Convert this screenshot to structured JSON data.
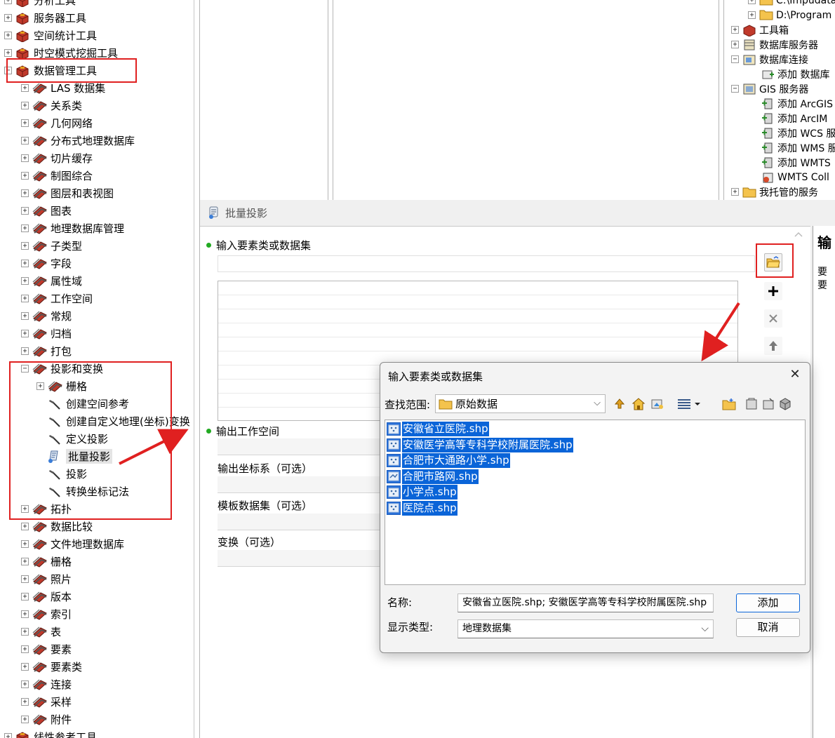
{
  "toolbox": {
    "items": [
      {
        "label": "分析工具",
        "level": 0,
        "expander": "+",
        "icon": "red-toolbox-icon"
      },
      {
        "label": "服务器工具",
        "level": 0,
        "expander": "+",
        "icon": "red-toolbox-icon"
      },
      {
        "label": "空间统计工具",
        "level": 0,
        "expander": "+",
        "icon": "red-toolbox-icon"
      },
      {
        "label": "时空模式挖掘工具",
        "level": 0,
        "expander": "+",
        "icon": "red-toolbox-icon"
      },
      {
        "label": "数据管理工具",
        "level": 0,
        "expander": "-",
        "icon": "red-toolbox-icon"
      },
      {
        "label": "LAS 数据集",
        "level": 1,
        "expander": "+",
        "icon": "toolset-icon"
      },
      {
        "label": "关系类",
        "level": 1,
        "expander": "+",
        "icon": "toolset-icon"
      },
      {
        "label": "几何网络",
        "level": 1,
        "expander": "+",
        "icon": "toolset-icon"
      },
      {
        "label": "分布式地理数据库",
        "level": 1,
        "expander": "+",
        "icon": "toolset-icon"
      },
      {
        "label": "切片缓存",
        "level": 1,
        "expander": "+",
        "icon": "toolset-icon"
      },
      {
        "label": "制图综合",
        "level": 1,
        "expander": "+",
        "icon": "toolset-icon"
      },
      {
        "label": "图层和表视图",
        "level": 1,
        "expander": "+",
        "icon": "toolset-icon"
      },
      {
        "label": "图表",
        "level": 1,
        "expander": "+",
        "icon": "toolset-icon"
      },
      {
        "label": "地理数据库管理",
        "level": 1,
        "expander": "+",
        "icon": "toolset-icon"
      },
      {
        "label": "子类型",
        "level": 1,
        "expander": "+",
        "icon": "toolset-icon"
      },
      {
        "label": "字段",
        "level": 1,
        "expander": "+",
        "icon": "toolset-icon"
      },
      {
        "label": "属性域",
        "level": 1,
        "expander": "+",
        "icon": "toolset-icon"
      },
      {
        "label": "工作空间",
        "level": 1,
        "expander": "+",
        "icon": "toolset-icon"
      },
      {
        "label": "常规",
        "level": 1,
        "expander": "+",
        "icon": "toolset-icon"
      },
      {
        "label": "归档",
        "level": 1,
        "expander": "+",
        "icon": "toolset-icon"
      },
      {
        "label": "打包",
        "level": 1,
        "expander": "+",
        "icon": "toolset-icon"
      },
      {
        "label": "投影和变换",
        "level": 1,
        "expander": "-",
        "icon": "toolset-icon"
      },
      {
        "label": "栅格",
        "level": 2,
        "expander": "+",
        "icon": "toolset-icon"
      },
      {
        "label": "创建空间参考",
        "level": 2,
        "expander": "",
        "icon": "hammer-icon"
      },
      {
        "label": "创建自定义地理(坐标)变换",
        "level": 2,
        "expander": "",
        "icon": "hammer-icon"
      },
      {
        "label": "定义投影",
        "level": 2,
        "expander": "",
        "icon": "hammer-icon"
      },
      {
        "label": "批量投影",
        "level": 2,
        "expander": "",
        "icon": "script-icon"
      },
      {
        "label": "投影",
        "level": 2,
        "expander": "",
        "icon": "hammer-icon"
      },
      {
        "label": "转换坐标记法",
        "level": 2,
        "expander": "",
        "icon": "hammer-icon"
      },
      {
        "label": "拓扑",
        "level": 1,
        "expander": "+",
        "icon": "toolset-icon"
      },
      {
        "label": "数据比较",
        "level": 1,
        "expander": "+",
        "icon": "toolset-icon"
      },
      {
        "label": "文件地理数据库",
        "level": 1,
        "expander": "+",
        "icon": "toolset-icon"
      },
      {
        "label": "栅格",
        "level": 1,
        "expander": "+",
        "icon": "toolset-icon"
      },
      {
        "label": "照片",
        "level": 1,
        "expander": "+",
        "icon": "toolset-icon"
      },
      {
        "label": "版本",
        "level": 1,
        "expander": "+",
        "icon": "toolset-icon"
      },
      {
        "label": "索引",
        "level": 1,
        "expander": "+",
        "icon": "toolset-icon"
      },
      {
        "label": "表",
        "level": 1,
        "expander": "+",
        "icon": "toolset-icon"
      },
      {
        "label": "要素",
        "level": 1,
        "expander": "+",
        "icon": "toolset-icon"
      },
      {
        "label": "要素类",
        "level": 1,
        "expander": "+",
        "icon": "toolset-icon"
      },
      {
        "label": "连接",
        "level": 1,
        "expander": "+",
        "icon": "toolset-icon"
      },
      {
        "label": "采样",
        "level": 1,
        "expander": "+",
        "icon": "toolset-icon"
      },
      {
        "label": "附件",
        "level": 1,
        "expander": "+",
        "icon": "toolset-icon"
      },
      {
        "label": "线性参考工具",
        "level": 0,
        "expander": "+",
        "icon": "red-toolbox-icon"
      }
    ]
  },
  "catalog": {
    "items": [
      {
        "label": "C:\\Impudata",
        "level": 1,
        "expander": "+",
        "icon": "folder-icon"
      },
      {
        "label": "D:\\Program",
        "level": 1,
        "expander": "+",
        "icon": "folder-icon"
      },
      {
        "label": "工具箱",
        "level": 0,
        "expander": "+",
        "icon": "toolbox-icon"
      },
      {
        "label": "数据库服务器",
        "level": 0,
        "expander": "+",
        "icon": "database-server-icon"
      },
      {
        "label": "数据库连接",
        "level": 0,
        "expander": "-",
        "icon": "database-connection-icon"
      },
      {
        "label": "添加 数据库",
        "level": 1,
        "expander": "",
        "icon": "add-connection-icon"
      },
      {
        "label": "GIS 服务器",
        "level": 0,
        "expander": "-",
        "icon": "gis-server-icon"
      },
      {
        "label": "添加 ArcGIS",
        "level": 1,
        "expander": "",
        "icon": "add-server-icon"
      },
      {
        "label": "添加 ArcIM",
        "level": 1,
        "expander": "",
        "icon": "add-server-icon"
      },
      {
        "label": "添加 WCS 服",
        "level": 1,
        "expander": "",
        "icon": "add-server-icon"
      },
      {
        "label": "添加 WMS 服",
        "level": 1,
        "expander": "",
        "icon": "add-server-icon"
      },
      {
        "label": "添加 WMTS",
        "level": 1,
        "expander": "",
        "icon": "add-server-icon"
      },
      {
        "label": "WMTS Coll",
        "level": 1,
        "expander": "",
        "icon": "wmts-icon"
      },
      {
        "label": "我托管的服务",
        "level": 0,
        "expander": "+",
        "icon": "hosted-services-icon"
      }
    ]
  },
  "tool": {
    "title": "批量投影",
    "input_label": "输入要素类或数据集",
    "output_workspace_label": "输出工作空间",
    "output_cs_label": "输出坐标系（可选）",
    "template_label": "模板数据集（可选）",
    "transform_label": "变换（可选）",
    "help_title_partial": "输",
    "help_text_line1": "要",
    "help_text_line2": "要"
  },
  "dialog": {
    "title": "输入要素类或数据集",
    "close_glyph": "✕",
    "look_in_label": "查找范围:",
    "look_in_value": "原始数据",
    "files": [
      {
        "name": "安徽省立医院.shp",
        "icon": "point-feature-icon"
      },
      {
        "name": "安徽医学高等专科学校附属医院.shp",
        "icon": "point-feature-icon"
      },
      {
        "name": "合肥市大通路小学.shp",
        "icon": "point-feature-icon"
      },
      {
        "name": "合肥市路网.shp",
        "icon": "line-feature-icon"
      },
      {
        "name": "小学点.shp",
        "icon": "point-feature-icon"
      },
      {
        "name": "医院点.shp",
        "icon": "point-feature-icon"
      }
    ],
    "name_label": "名称:",
    "name_value": "安徽省立医院.shp; 安徽医学高等专科学校附属医院.shp",
    "type_label": "显示类型:",
    "type_value": "地理数据集",
    "add_button": "添加",
    "cancel_button": "取消"
  },
  "colors": {
    "annotation_red": "#e02020",
    "selection_blue": "#0a64d8",
    "required_dot_green": "#22aa22"
  }
}
